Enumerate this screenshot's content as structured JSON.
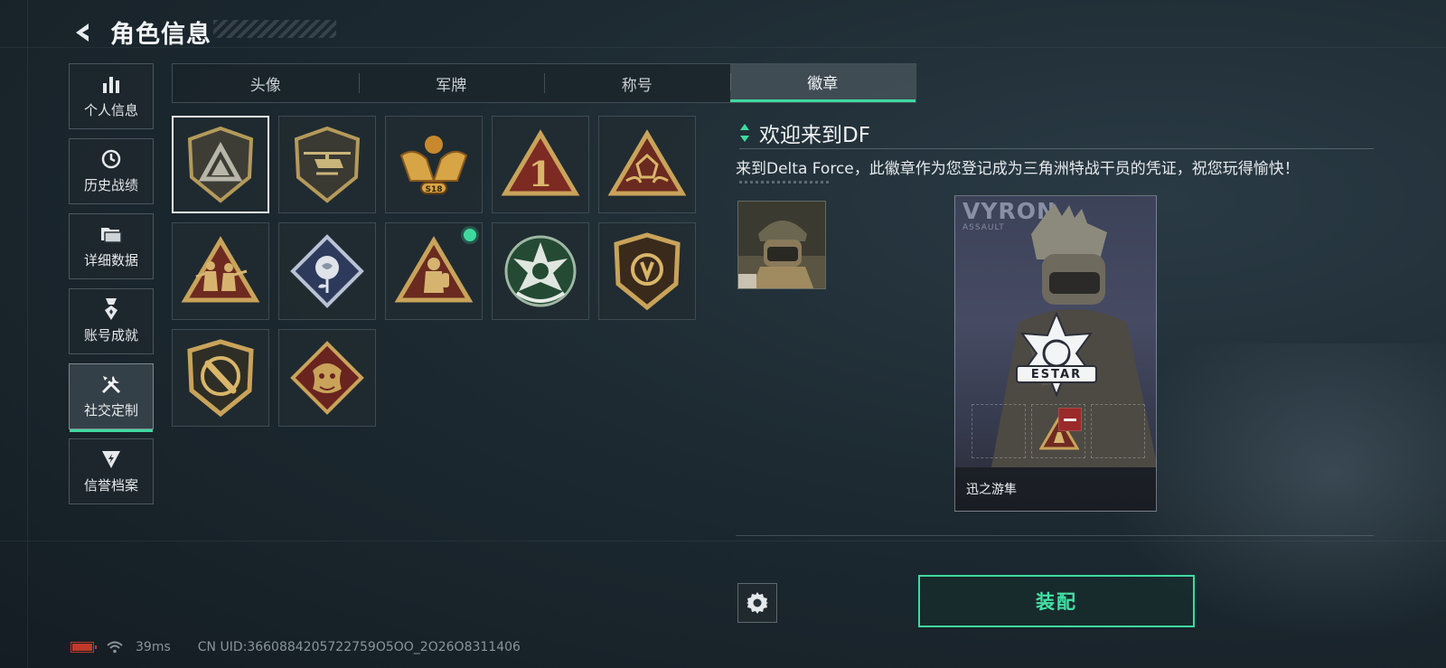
{
  "header": {
    "title": "角色信息"
  },
  "sidebar": {
    "items": [
      {
        "label": "个人信息",
        "icon": "bar-chart-icon"
      },
      {
        "label": "历史战绩",
        "icon": "clock-icon"
      },
      {
        "label": "详细数据",
        "icon": "folder-icon"
      },
      {
        "label": "账号成就",
        "icon": "medal-icon"
      },
      {
        "label": "社交定制",
        "icon": "tools-icon",
        "active": true
      },
      {
        "label": "信誉档案",
        "icon": "shield-bolt-icon"
      }
    ]
  },
  "tabs": [
    {
      "label": "头像"
    },
    {
      "label": "军牌"
    },
    {
      "label": "称号"
    },
    {
      "label": "徽章",
      "active": true
    }
  ],
  "badges": [
    {
      "name": "delta-triangle-badge",
      "selected": true
    },
    {
      "name": "helicopter-badge"
    },
    {
      "name": "eagle-badge",
      "text": "S18"
    },
    {
      "name": "number-one-badge",
      "text": "1"
    },
    {
      "name": "dice-hands-badge"
    },
    {
      "name": "soldiers-badge"
    },
    {
      "name": "rose-badge"
    },
    {
      "name": "firefighter-badge",
      "is_new": true
    },
    {
      "name": "star-skull-badge"
    },
    {
      "name": "eye-shield-badge"
    },
    {
      "name": "knife-badge"
    },
    {
      "name": "dragon-badge"
    }
  ],
  "detail": {
    "title": "欢迎来到DF",
    "description": "来到Delta Force，此徽章作为您登记成为三角洲特战干员的凭证，祝您玩得愉快！"
  },
  "card": {
    "brand": "VYRON",
    "subtitle": "ASSAULT",
    "emblem_text": "ESTAR",
    "name": "迅之游隼"
  },
  "actions": {
    "equip_label": "装配"
  },
  "status": {
    "ping": "39ms",
    "uid": "CN UID:3660884205722759O5OO_2O26O8311406"
  },
  "colors": {
    "accent": "#3fd9a0",
    "remove": "#9b2a2a",
    "battery": "#c0392b"
  }
}
